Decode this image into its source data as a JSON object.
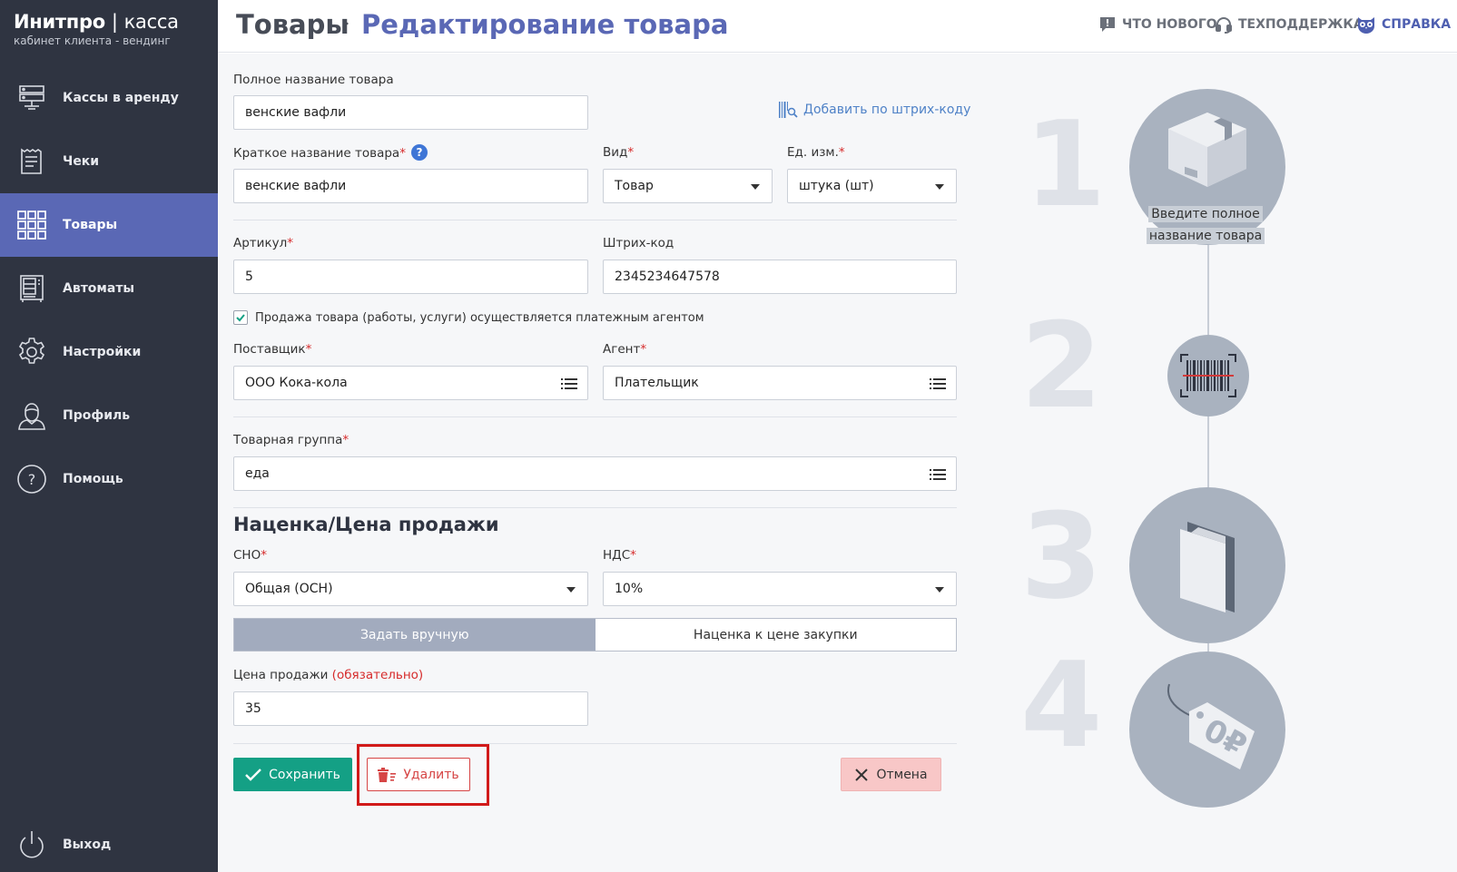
{
  "brand": {
    "name_bold": "Инитпро",
    "name_sep": "|",
    "name_thin": "касса",
    "subtitle": "кабинет клиента - вендинг"
  },
  "sidebar": {
    "items": [
      {
        "label": "Кассы в аренду",
        "icon": "server-icon"
      },
      {
        "label": "Чеки",
        "icon": "receipt-icon"
      },
      {
        "label": "Товары",
        "icon": "grid-icon",
        "active": true
      },
      {
        "label": "Автоматы",
        "icon": "vending-machine-icon"
      },
      {
        "label": "Настройки",
        "icon": "gear-icon"
      },
      {
        "label": "Профиль",
        "icon": "user-icon"
      },
      {
        "label": "Помощь",
        "icon": "help-circle-icon"
      }
    ],
    "logout": {
      "label": "Выход",
      "icon": "power-icon"
    }
  },
  "header": {
    "crumb_root": "Товары",
    "crumb_current": "Редактирование товара",
    "links": [
      {
        "label": "ЧТО НОВОГО",
        "icon": "news-icon"
      },
      {
        "label": "ТЕХПОДДЕРЖКА",
        "icon": "headset-icon"
      },
      {
        "label": "СПРАВКА",
        "icon": "owl-icon"
      }
    ]
  },
  "form": {
    "full_name": {
      "label": "Полное название товара",
      "value": "венские вафли"
    },
    "barcode_link": "Добавить по штрих-коду",
    "short_name": {
      "label": "Краткое название товара",
      "required": "*",
      "value": "венские вафли",
      "help": "?"
    },
    "kind": {
      "label": "Вид",
      "required": "*",
      "value": "Товар"
    },
    "unit": {
      "label": "Ед. изм.",
      "required": "*",
      "value": "штука (шт)"
    },
    "article": {
      "label": "Артикул",
      "required": "*",
      "value": "5"
    },
    "barcode": {
      "label": "Штрих-код",
      "value": "2345234647578"
    },
    "agent_checkbox": {
      "label": "Продажа товара (работы, услуги) осуществляется платежным агентом",
      "checked": true
    },
    "supplier": {
      "label": "Поставщик",
      "required": "*",
      "value": "ООО Кока-кола"
    },
    "agent": {
      "label": "Агент",
      "required": "*",
      "value": "Плательщик"
    },
    "group": {
      "label": "Товарная группа",
      "required": "*",
      "value": "еда"
    },
    "section_title": "Наценка/Цена продажи",
    "sno": {
      "label": "СНО",
      "required": "*",
      "value": "Общая (ОСН)"
    },
    "nds": {
      "label": "НДС",
      "required": "*",
      "value": "10%"
    },
    "toggle": {
      "manual": "Задать вручную",
      "markup": "Наценка к цене закупки"
    },
    "price": {
      "label": "Цена продажи",
      "required_note": "(обязательно)",
      "value": "35"
    },
    "buttons": {
      "save": "Сохранить",
      "delete": "Удалить",
      "cancel": "Отмена"
    }
  },
  "steps": {
    "numbers": [
      "1",
      "2",
      "3",
      "4"
    ],
    "caption_line1": "Введите полное",
    "caption_line2": "название товара"
  },
  "colors": {
    "sidebar_bg": "#2f3441",
    "accent": "#5a68b5",
    "save": "#14a085",
    "delete": "#d64545",
    "cancel_bg": "#f8c7c7"
  }
}
